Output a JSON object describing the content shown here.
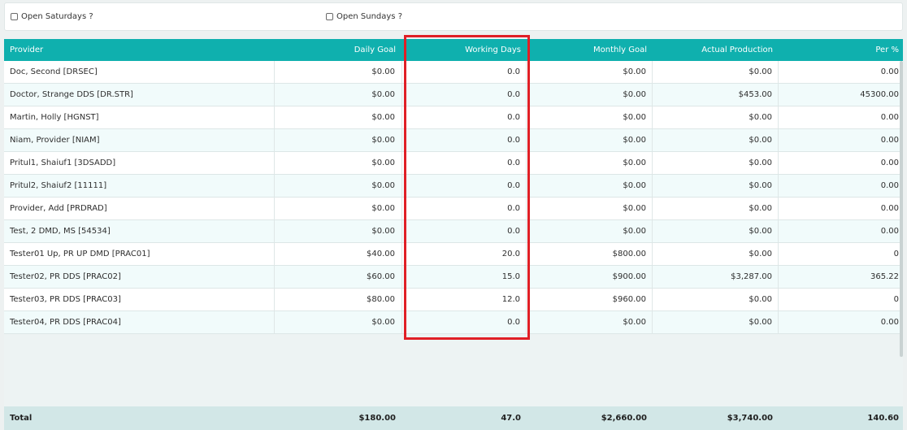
{
  "filters": {
    "open_saturdays_label": "Open Saturdays ?",
    "open_sundays_label": "Open Sundays ?"
  },
  "table": {
    "columns": [
      "Provider",
      "Daily Goal",
      "Working Days",
      "Monthly Goal",
      "Actual Production",
      "Per %"
    ],
    "rows": [
      [
        "Doc, Second [DRSEC]",
        "$0.00",
        "0.0",
        "$0.00",
        "$0.00",
        "0.00"
      ],
      [
        "Doctor, Strange DDS [DR.STR]",
        "$0.00",
        "0.0",
        "$0.00",
        "$453.00",
        "45300.00"
      ],
      [
        "Martin, Holly [HGNST]",
        "$0.00",
        "0.0",
        "$0.00",
        "$0.00",
        "0.00"
      ],
      [
        "Niam, Provider [NIAM]",
        "$0.00",
        "0.0",
        "$0.00",
        "$0.00",
        "0.00"
      ],
      [
        "Pritul1, Shaiuf1 [3DSADD]",
        "$0.00",
        "0.0",
        "$0.00",
        "$0.00",
        "0.00"
      ],
      [
        "Pritul2, Shaiuf2 [11111]",
        "$0.00",
        "0.0",
        "$0.00",
        "$0.00",
        "0.00"
      ],
      [
        "Provider, Add [PRDRAD]",
        "$0.00",
        "0.0",
        "$0.00",
        "$0.00",
        "0.00"
      ],
      [
        "Test, 2 DMD, MS [54534]",
        "$0.00",
        "0.0",
        "$0.00",
        "$0.00",
        "0.00"
      ],
      [
        "Tester01 Up, PR UP DMD [PRAC01]",
        "$40.00",
        "20.0",
        "$800.00",
        "$0.00",
        "0"
      ],
      [
        "Tester02, PR DDS [PRAC02]",
        "$60.00",
        "15.0",
        "$900.00",
        "$3,287.00",
        "365.22"
      ],
      [
        "Tester03, PR DDS [PRAC03]",
        "$80.00",
        "12.0",
        "$960.00",
        "$0.00",
        "0"
      ],
      [
        "Tester04, PR DDS [PRAC04]",
        "$0.00",
        "0.0",
        "$0.00",
        "$0.00",
        "0.00"
      ]
    ],
    "totals": [
      "Total",
      "$180.00",
      "47.0",
      "$2,660.00",
      "$3,740.00",
      "140.60"
    ]
  },
  "colors": {
    "header_bg": "#0fb0ae",
    "highlight_border": "#e01f26",
    "total_bg": "#d2e7e7"
  }
}
